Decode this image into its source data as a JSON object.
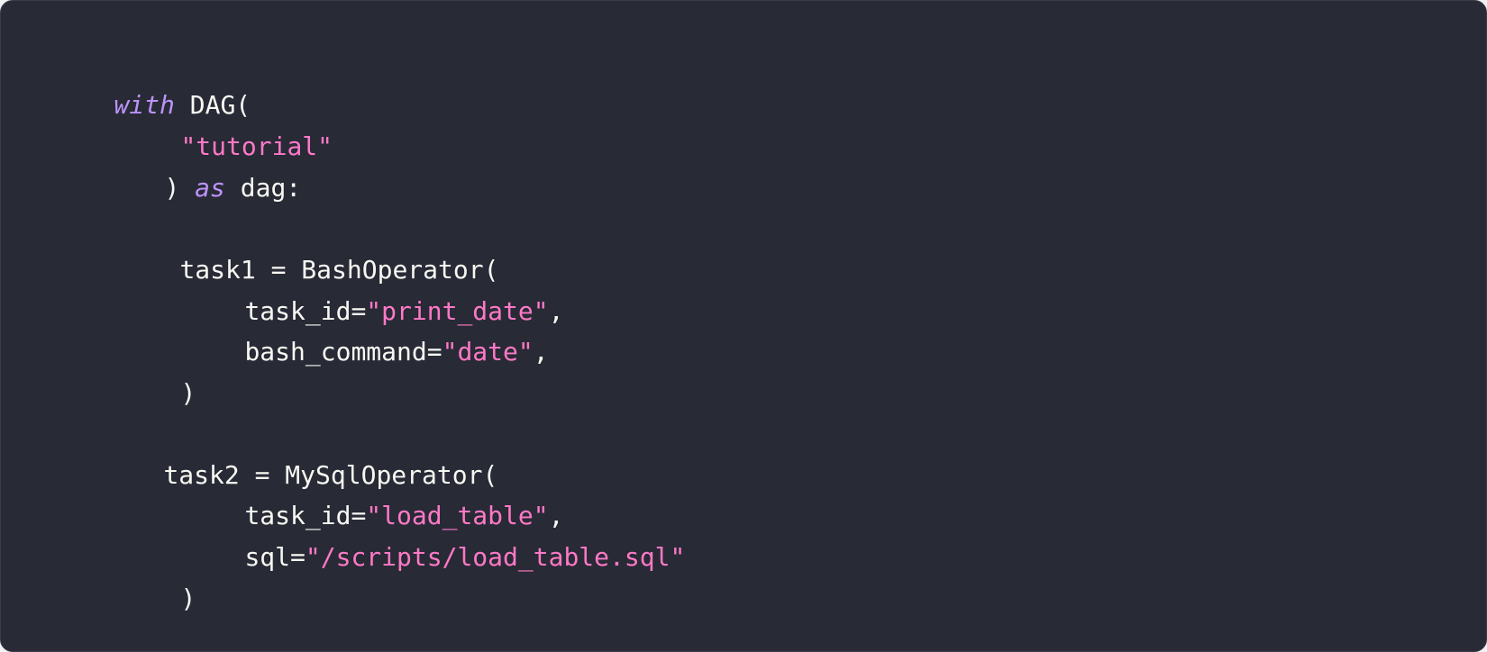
{
  "colors": {
    "background": "#282a36",
    "text": "#f8f8f2",
    "keyword": "#bd93f9",
    "string": "#ff79c6"
  },
  "code": {
    "line1": {
      "kw_with": "with",
      "dag_call": " DAG("
    },
    "line2": {
      "dag_name": "\"tutorial\""
    },
    "line3": {
      "close_paren": ") ",
      "kw_as": "as",
      "dag_var": " dag:"
    },
    "line5": {
      "text": "task1 = BashOperator("
    },
    "line6": {
      "arg": "task_id=",
      "value": "\"print_date\"",
      "comma": ","
    },
    "line7": {
      "arg": "bash_command=",
      "value": "\"date\"",
      "comma": ","
    },
    "line8": {
      "text": ")"
    },
    "line10": {
      "text": "task2 = MySqlOperator("
    },
    "line11": {
      "arg": "task_id=",
      "value": "\"load_table\"",
      "comma": ","
    },
    "line12": {
      "arg": "sql=",
      "value": "\"/scripts/load_table.sql\""
    },
    "line13": {
      "text": ")"
    }
  }
}
